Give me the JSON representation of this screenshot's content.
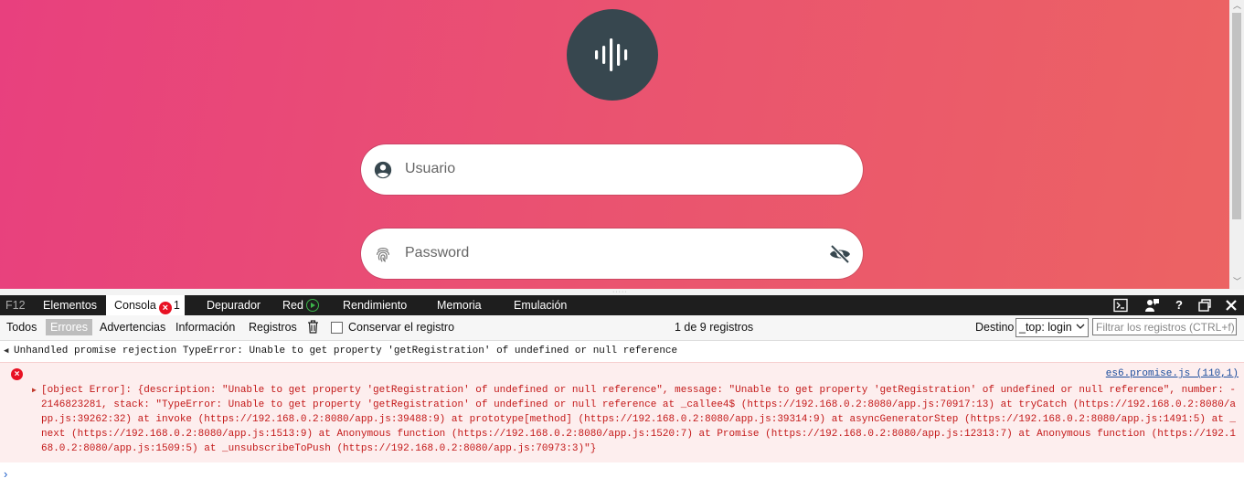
{
  "login": {
    "username_placeholder": "Usuario",
    "password_placeholder": "Password"
  },
  "devtools": {
    "f12_label": "F12",
    "tabs": [
      {
        "label": "Elementos"
      },
      {
        "label": "Consola",
        "error_count": "1"
      },
      {
        "label": "Depurador"
      },
      {
        "label": "Red"
      },
      {
        "label": "Rendimiento"
      },
      {
        "label": "Memoria"
      },
      {
        "label": "Emulación"
      }
    ],
    "right_icons": [
      "console-icon",
      "feedback-icon",
      "help-icon",
      "undock-icon",
      "close-icon"
    ]
  },
  "console_toolbar": {
    "filters": [
      "Todos",
      "Errores",
      "Advertencias",
      "Información",
      "Registros"
    ],
    "active_filter": "Errores",
    "preserve_label": "Conservar el registro",
    "records_count": "1 de 9 registros",
    "destino_label": "Destino",
    "destino_value": "_top: login",
    "filter_placeholder": "Filtrar los registros (CTRL+f)"
  },
  "console": {
    "message_1": "Unhandled promise rejection TypeError: Unable to get property 'getRegistration' of undefined or null reference",
    "error_source": "es6.promise.js (110,1)",
    "error_text": "[object Error]: {description: \"Unable to get property 'getRegistration' of undefined or null reference\", message: \"Unable to get property 'getRegistration' of undefined or null reference\", number: -2146823281, stack: \"TypeError: Unable to get property 'getRegistration' of undefined or null reference at _callee4$ (https://192.168.0.2:8080/app.js:70917:13) at tryCatch (https://192.168.0.2:8080/app.js:39262:32) at invoke (https://192.168.0.2:8080/app.js:39488:9) at prototype[method] (https://192.168.0.2:8080/app.js:39314:9) at asyncGeneratorStep (https://192.168.0.2:8080/app.js:1491:5) at _next (https://192.168.0.2:8080/app.js:1513:9) at Anonymous function (https://192.168.0.2:8080/app.js:1520:7) at Promise (https://192.168.0.2:8080/app.js:12313:7) at Anonymous function (https://192.168.0.2:8080/app.js:1509:5) at _unsubscribeToPush (https://192.168.0.2:8080/app.js:70973:3)\"}"
  },
  "colors": {
    "gradient_start": "#e8407e",
    "gradient_end": "#ec6363",
    "logo_bg": "#37474f",
    "error_red": "#e81123"
  }
}
